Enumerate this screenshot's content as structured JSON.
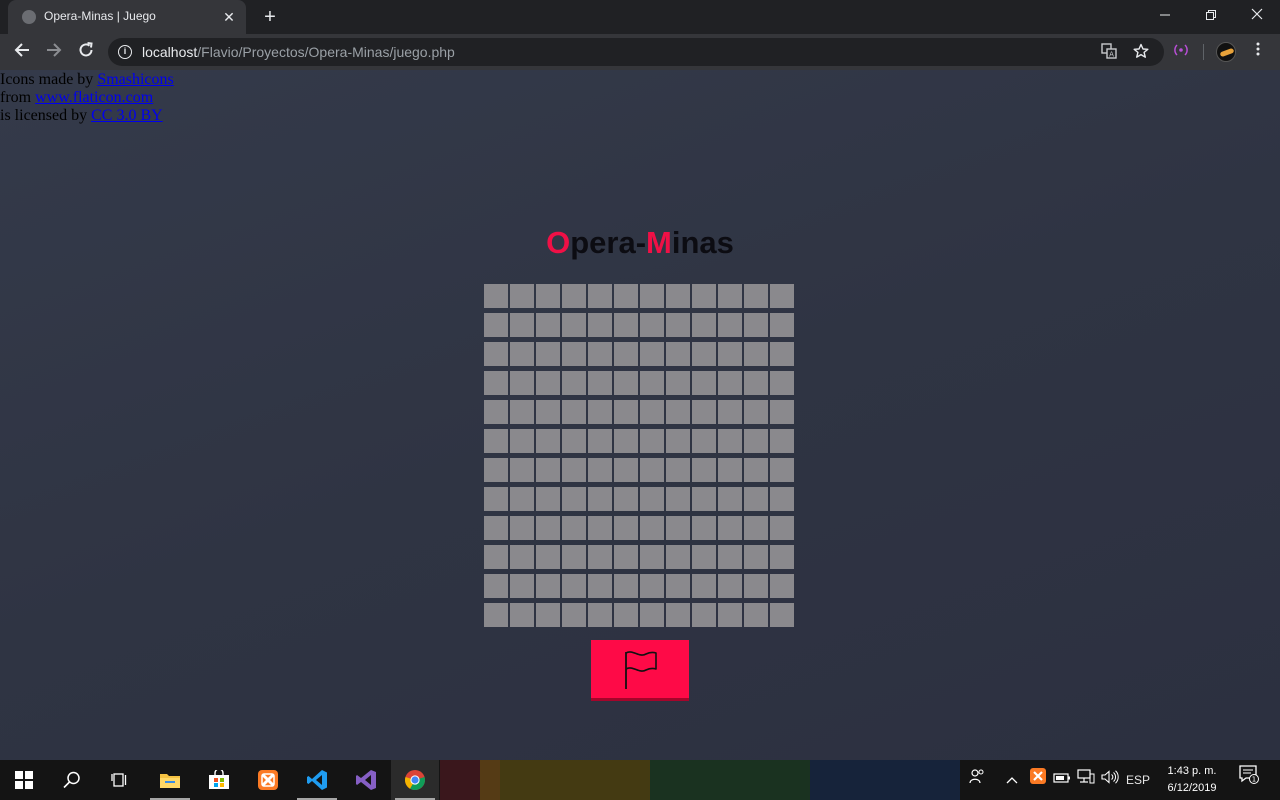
{
  "browser": {
    "tab_title": "Opera-Minas | Juego",
    "new_tab_symbol": "+",
    "tab_close_symbol": "✕",
    "url_host": "localhost",
    "url_path": "/Flavio/Proyectos/Opera-Minas/juego.php",
    "icons": [
      "favicon-globe",
      "back-arrow",
      "forward-arrow",
      "reload",
      "site-info",
      "translate",
      "bookmark-star",
      "cast-extension",
      "profile-avatar",
      "menu-kebab",
      "minimize",
      "restore",
      "close"
    ]
  },
  "credits": {
    "line1_prefix": "Icons made by",
    "line1_link": "Smashicons",
    "line2_prefix": "from",
    "line2_link": "www.flaticon.com",
    "line3_prefix": "is licensed by",
    "line3_link": "CC 3.0 BY"
  },
  "game": {
    "title_first_accent": "O",
    "title_first_rest": "pera-",
    "title_second_accent": "M",
    "title_second_rest": "inas",
    "board_rows": 12,
    "board_cols": 12,
    "accent_color": "#fe0a47",
    "cell_color": "#8a898d",
    "flag_button_icon": "flag-icon"
  },
  "taskbar": {
    "apps": [
      "windows-start",
      "search",
      "task-view",
      "file-explorer",
      "microsoft-store",
      "xampp",
      "vs-code",
      "visual-studio",
      "chrome"
    ],
    "language": "ESP",
    "time": "1:43 p. m.",
    "date": "6/12/2019",
    "notification_count": "1"
  }
}
